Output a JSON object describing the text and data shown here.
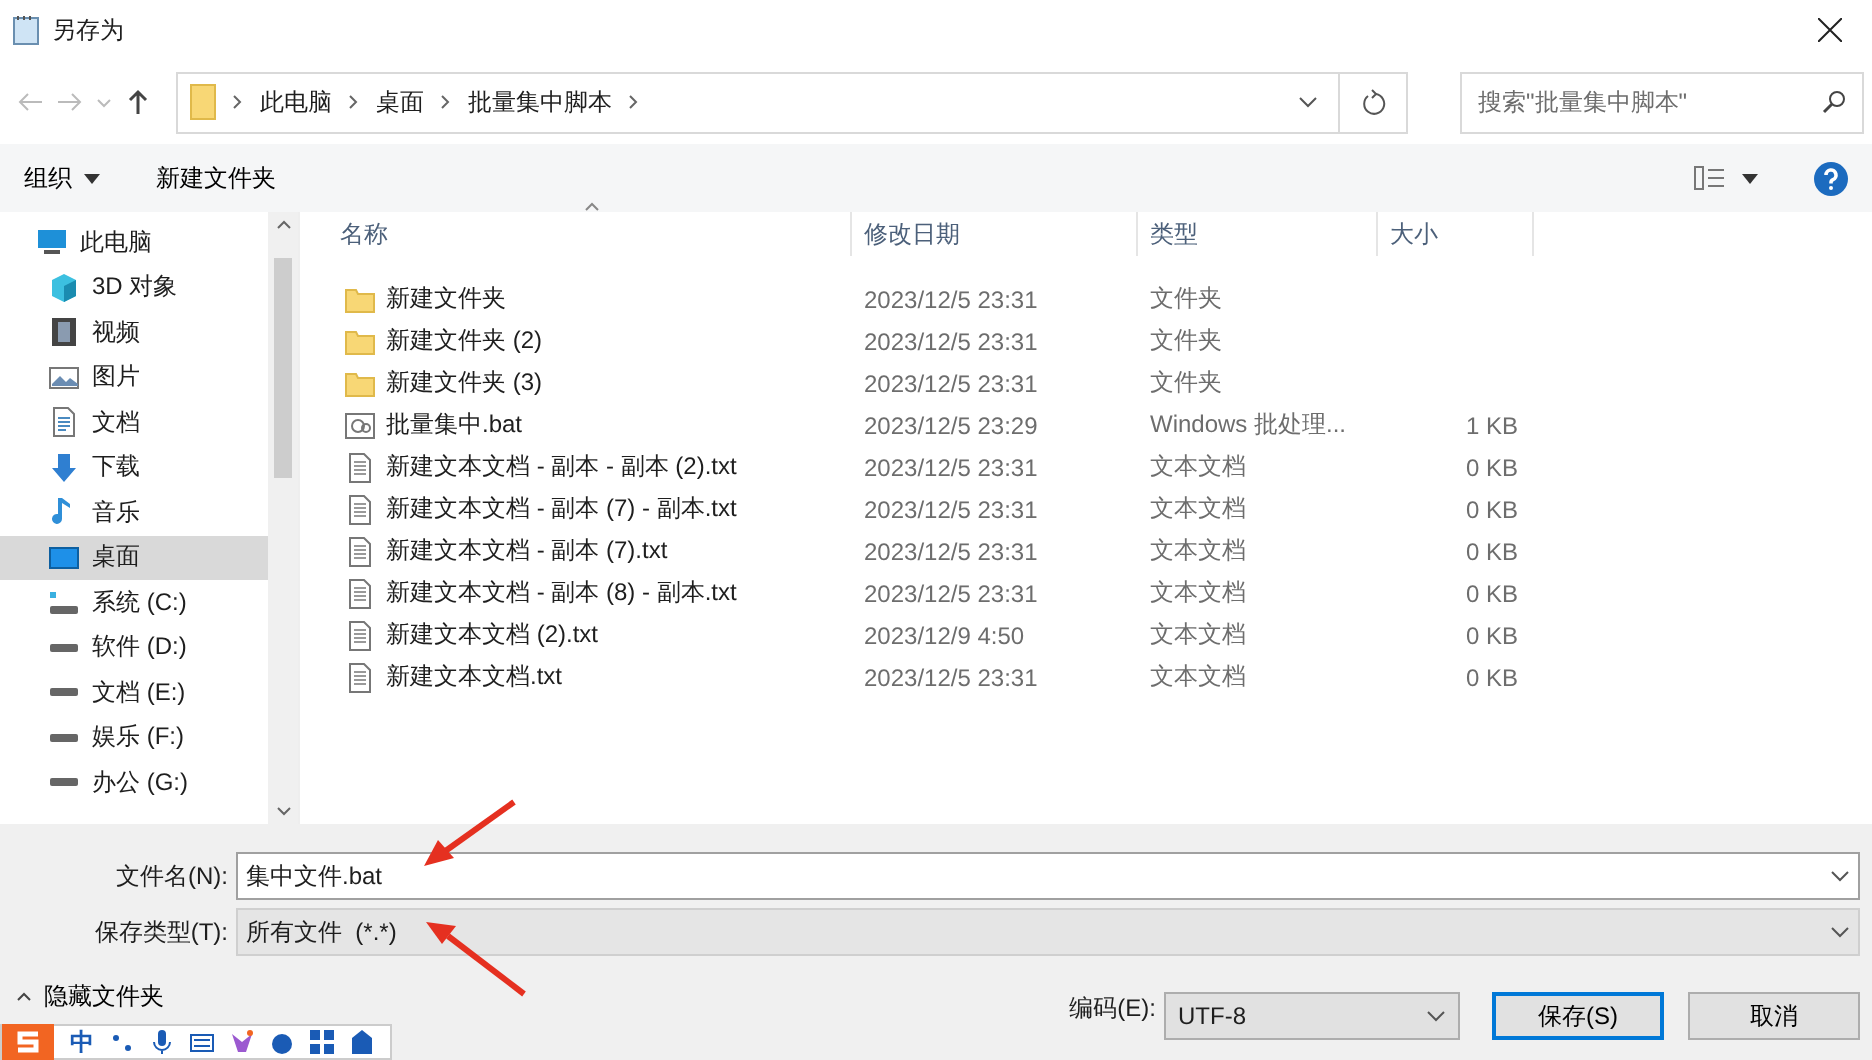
{
  "window": {
    "title": "另存为"
  },
  "address": {
    "crumbs": [
      "此电脑",
      "桌面",
      "批量集中脚本"
    ],
    "search_placeholder": "搜索\"批量集中脚本\""
  },
  "toolbar": {
    "organize": "组织",
    "new_folder": "新建文件夹"
  },
  "sidebar": {
    "items": [
      {
        "kind": "pc",
        "label": "此电脑",
        "selected": false
      },
      {
        "kind": "cube",
        "label": "3D 对象",
        "selected": false
      },
      {
        "kind": "film",
        "label": "视频",
        "selected": false
      },
      {
        "kind": "picture",
        "label": "图片",
        "selected": false
      },
      {
        "kind": "doc",
        "label": "文档",
        "selected": false
      },
      {
        "kind": "download",
        "label": "下载",
        "selected": false
      },
      {
        "kind": "music",
        "label": "音乐",
        "selected": false
      },
      {
        "kind": "desktop",
        "label": "桌面",
        "selected": true
      },
      {
        "kind": "sysdrive",
        "label": "系统 (C:)",
        "selected": false
      },
      {
        "kind": "drive",
        "label": "软件 (D:)",
        "selected": false
      },
      {
        "kind": "drive",
        "label": "文档 (E:)",
        "selected": false
      },
      {
        "kind": "drive",
        "label": "娱乐 (F:)",
        "selected": false
      },
      {
        "kind": "drive",
        "label": "办公 (G:)",
        "selected": false
      }
    ]
  },
  "table": {
    "columns": [
      "名称",
      "修改日期",
      "类型",
      "大小"
    ],
    "rows": [
      {
        "kind": "folder",
        "name": "新建文件夹",
        "modified": "2023/12/5 23:31",
        "type": "文件夹"
      },
      {
        "kind": "folder",
        "name": "新建文件夹 (2)",
        "modified": "2023/12/5 23:31",
        "type": "文件夹"
      },
      {
        "kind": "folder",
        "name": "新建文件夹 (3)",
        "modified": "2023/12/5 23:31",
        "type": "文件夹"
      },
      {
        "kind": "bat",
        "name": "批量集中.bat",
        "modified": "2023/12/5 23:29",
        "type": "Windows 批处理...",
        "size": "1 KB"
      },
      {
        "kind": "txt",
        "name": "新建文本文档 - 副本 - 副本 (2).txt",
        "modified": "2023/12/5 23:31",
        "type": "文本文档",
        "size": "0 KB"
      },
      {
        "kind": "txt",
        "name": "新建文本文档 - 副本 (7) - 副本.txt",
        "modified": "2023/12/5 23:31",
        "type": "文本文档",
        "size": "0 KB"
      },
      {
        "kind": "txt",
        "name": "新建文本文档 - 副本 (7).txt",
        "modified": "2023/12/5 23:31",
        "type": "文本文档",
        "size": "0 KB"
      },
      {
        "kind": "txt",
        "name": "新建文本文档 - 副本 (8) - 副本.txt",
        "modified": "2023/12/5 23:31",
        "type": "文本文档",
        "size": "0 KB"
      },
      {
        "kind": "txt",
        "name": "新建文本文档 (2).txt",
        "modified": "2023/12/9 4:50",
        "type": "文本文档",
        "size": "0 KB"
      },
      {
        "kind": "txt",
        "name": "新建文本文档.txt",
        "modified": "2023/12/5 23:31",
        "type": "文本文档",
        "size": "0 KB"
      }
    ]
  },
  "form": {
    "filename_label": "文件名(N):",
    "filename": "集中文件.bat",
    "type_label": "保存类型(T):",
    "type": "所有文件  (*.*)",
    "hide_folders": "隐藏文件夹",
    "encoding_label": "编码(E):",
    "encoding": "UTF-8",
    "save": "保存(S)",
    "cancel": "取消"
  },
  "ime": {
    "mode": "中"
  }
}
